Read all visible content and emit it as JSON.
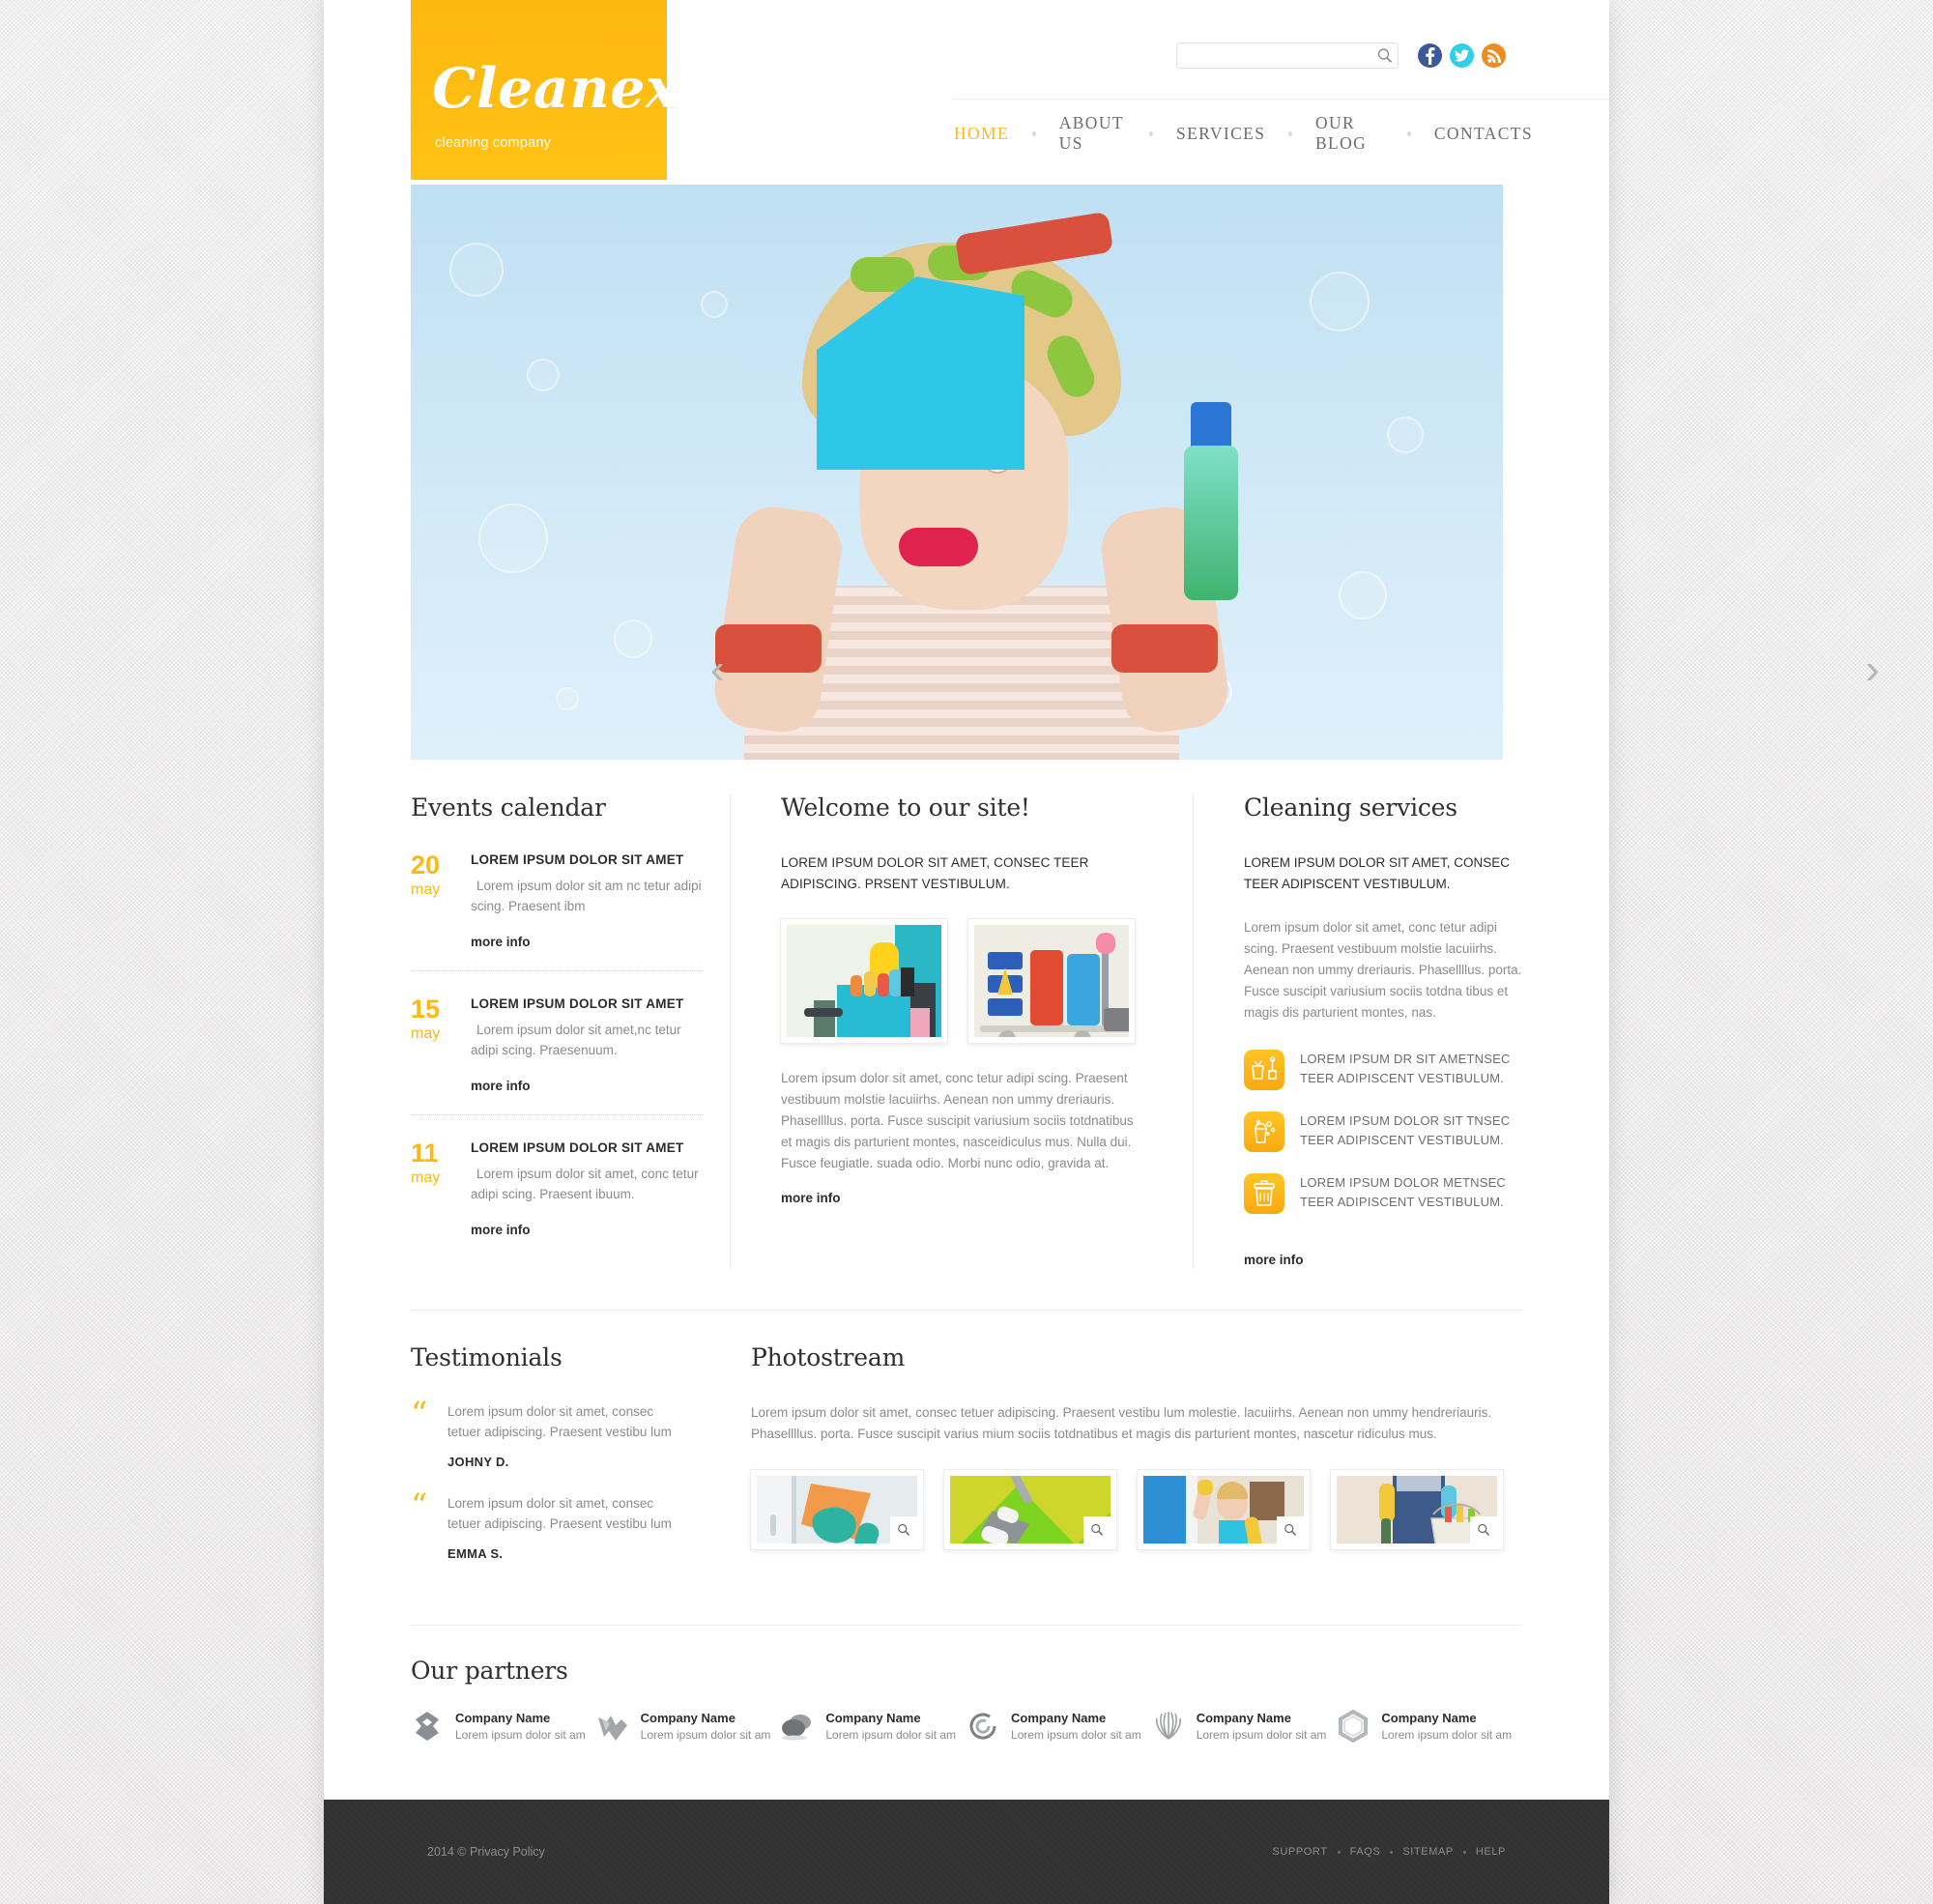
{
  "brand": {
    "name": "Cleanex",
    "tagline": "cleaning company"
  },
  "search": {
    "value": "",
    "placeholder": "",
    "icon": "search-icon"
  },
  "socials": [
    {
      "name": "facebook-icon",
      "glyph": "f",
      "color": "#3b5998"
    },
    {
      "name": "twitter-icon",
      "glyph": "",
      "color": "#2fd0e8"
    },
    {
      "name": "rss-icon",
      "glyph": "",
      "color": "#f08c1e"
    }
  ],
  "nav": [
    {
      "label": "HOME",
      "active": true
    },
    {
      "label": "ABOUT US",
      "active": false
    },
    {
      "label": "SERVICES",
      "active": false
    },
    {
      "label": "OUR BLOG",
      "active": false
    },
    {
      "label": "CONTACTS",
      "active": false
    }
  ],
  "slider": {
    "prev": "‹",
    "next": "›"
  },
  "events": {
    "title": "Events calendar",
    "items": [
      {
        "day": "20",
        "month": "may",
        "title": "LOREM IPSUM DOLOR SIT AMET",
        "text": "Lorem ipsum dolor sit am nc tetur adipi scing. Praesent ibm",
        "link": "more info"
      },
      {
        "day": "15",
        "month": "may",
        "title": "LOREM IPSUM DOLOR SIT AMET",
        "text": "Lorem ipsum dolor sit amet,nc tetur adipi scing. Praesenuum.",
        "link": "more info"
      },
      {
        "day": "11",
        "month": "may",
        "title": "LOREM IPSUM DOLOR SIT AMET",
        "text": "Lorem ipsum dolor sit amet, conc tetur adipi scing. Praesent ibuum.",
        "link": "more info"
      }
    ]
  },
  "welcome": {
    "title": "Welcome to our site!",
    "lead": "LOREM IPSUM DOLOR SIT AMET, CONSEC TEER ADIPISCING. PRSENT VESTIBULUM.",
    "images": [
      {
        "name": "cleaning-supplies-bucket-photo"
      },
      {
        "name": "janitorial-cart-photo"
      }
    ],
    "body": "Lorem ipsum dolor sit amet, conc tetur adipi scing. Praesent vestibuum molstie lacuiirhs. Aenean non ummy dreriauris. Phasellllus. porta. Fusce suscipit variusium sociis totdnatibus et magis dis parturient montes, nasceidiculus mus. Nulla dui. Fusce feugiatle. suada odio. Morbi nunc odio, gravida at.",
    "link": "more info"
  },
  "services": {
    "title": "Cleaning services",
    "lead": "LOREM IPSUM DOLOR SIT AMET, CONSEC TEER ADIPISCENT VESTIBULUM.",
    "body": "Lorem ipsum dolor sit amet, conc tetur adipi scing. Praesent vestibuum molstie lacuiirhs. Aenean non ummy dreriauris. Phasellllus. porta. Fusce suscipit variusium sociis totdna tibus et magis dis parturient montes, nas.",
    "items": [
      {
        "icon": "bucket-broom-icon",
        "text": "LOREM IPSUM DR SIT AMETNSEC TEER ADIPISCENT VESTIBULUM."
      },
      {
        "icon": "soap-bubbles-icon",
        "text": "LOREM IPSUM DOLOR SIT TNSEC TEER ADIPISCENT VESTIBULUM."
      },
      {
        "icon": "trash-bin-icon",
        "text": "LOREM IPSUM DOLOR METNSEC TEER ADIPISCENT VESTIBULUM."
      }
    ],
    "link": "more info"
  },
  "testimonials": {
    "title": "Testimonials",
    "items": [
      {
        "text": "Lorem ipsum dolor sit amet, consec tetuer adipiscing. Praesent vestibu lum",
        "author": "JOHNY D."
      },
      {
        "text": "Lorem ipsum dolor sit amet, consec tetuer adipiscing. Praesent vestibu lum",
        "author": "EMMA S."
      }
    ]
  },
  "photostream": {
    "title": "Photostream",
    "text": "Lorem ipsum dolor sit amet, consec tetuer adipiscing. Praesent vestibu lum molestie. lacuiirhs. Aenean non ummy hendreriauris. Phasellllus. porta. Fusce suscipit varius mium sociis totdnatibus et magis dis parturient montes, nascetur ridiculus mus.",
    "thumbs": [
      {
        "name": "window-wiping-photo",
        "zoom_icon": "magnifier-icon"
      },
      {
        "name": "vacuum-carpet-photo",
        "zoom_icon": "magnifier-icon"
      },
      {
        "name": "woman-cleaning-window-photo",
        "zoom_icon": "magnifier-icon"
      },
      {
        "name": "cleaner-with-bucket-photo",
        "zoom_icon": "magnifier-icon"
      }
    ]
  },
  "partners": {
    "title": "Our partners",
    "items": [
      {
        "logo": "ribbon-logo",
        "name": "Company Name",
        "desc": "Lorem ipsum dolor sit am"
      },
      {
        "logo": "wing-logo",
        "name": "Company Name",
        "desc": "Lorem ipsum dolor sit am"
      },
      {
        "logo": "speech-bubbles-logo",
        "name": "Company Name",
        "desc": "Lorem ipsum dolor sit am"
      },
      {
        "logo": "spiral-circle-logo",
        "name": "Company Name",
        "desc": "Lorem ipsum dolor sit am"
      },
      {
        "logo": "flower-burst-logo",
        "name": "Company Name",
        "desc": "Lorem ipsum dolor sit am"
      },
      {
        "logo": "hex-ring-logo",
        "name": "Company Name",
        "desc": "Lorem ipsum dolor sit am"
      }
    ]
  },
  "footer": {
    "copyright": "2014 © Privacy Policy",
    "links": [
      {
        "label": "SUPPORT"
      },
      {
        "label": "FAQS"
      },
      {
        "label": "SITEMAP"
      },
      {
        "label": "HELP"
      }
    ]
  },
  "colors": {
    "accent": "#fdb913",
    "text": "#2c2c2c",
    "muted": "#8b8b8b",
    "footer_bg": "#333232"
  }
}
